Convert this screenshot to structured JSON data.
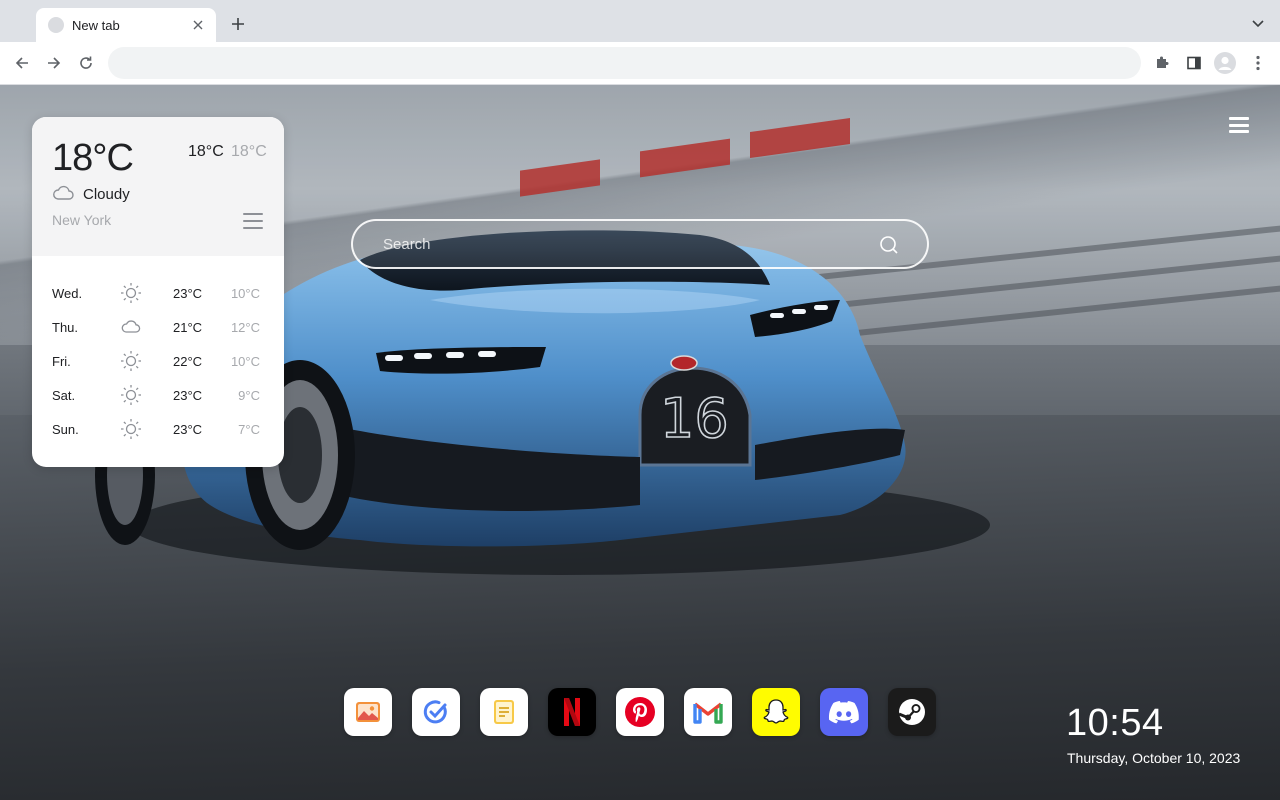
{
  "browser": {
    "tab": {
      "title": "New tab"
    },
    "omnibox": {
      "value": "",
      "placeholder": ""
    }
  },
  "weather": {
    "current_temp": "18°C",
    "high": "18°C",
    "low": "18°C",
    "condition": "Cloudy",
    "condition_icon": "cloud-icon",
    "city": "New York",
    "forecast": [
      {
        "day": "Wed.",
        "icon": "sun-icon",
        "high": "23°C",
        "low": "10°C"
      },
      {
        "day": "Thu.",
        "icon": "cloud-icon",
        "high": "21°C",
        "low": "12°C"
      },
      {
        "day": "Fri.",
        "icon": "sun-icon",
        "high": "22°C",
        "low": "10°C"
      },
      {
        "day": "Sat.",
        "icon": "sun-icon",
        "high": "23°C",
        "low": "9°C"
      },
      {
        "day": "Sun.",
        "icon": "sun-icon",
        "high": "23°C",
        "low": "7°C"
      }
    ]
  },
  "search": {
    "placeholder": "Search"
  },
  "dock": [
    {
      "name": "photos",
      "icon": "image-icon",
      "color": "#ffffff"
    },
    {
      "name": "tasks",
      "icon": "check-circle-icon",
      "color": "#ffffff"
    },
    {
      "name": "notes",
      "icon": "note-icon",
      "color": "#ffffff"
    },
    {
      "name": "netflix",
      "icon": "netflix-icon",
      "color": "#000000"
    },
    {
      "name": "pinterest",
      "icon": "pinterest-icon",
      "color": "#ffffff"
    },
    {
      "name": "gmail",
      "icon": "gmail-icon",
      "color": "#ffffff"
    },
    {
      "name": "snapchat",
      "icon": "snapchat-icon",
      "color": "#fffc00"
    },
    {
      "name": "discord",
      "icon": "discord-icon",
      "color": "#5865f2"
    },
    {
      "name": "steam",
      "icon": "steam-icon",
      "color": "#1b1b1b"
    }
  ],
  "clock": {
    "time": "10:54",
    "date": "Thursday, October 10, 2023"
  },
  "colors": {
    "accent_gmail_red": "#ea4335",
    "netflix_red": "#e50914",
    "pinterest_red": "#e60023"
  }
}
